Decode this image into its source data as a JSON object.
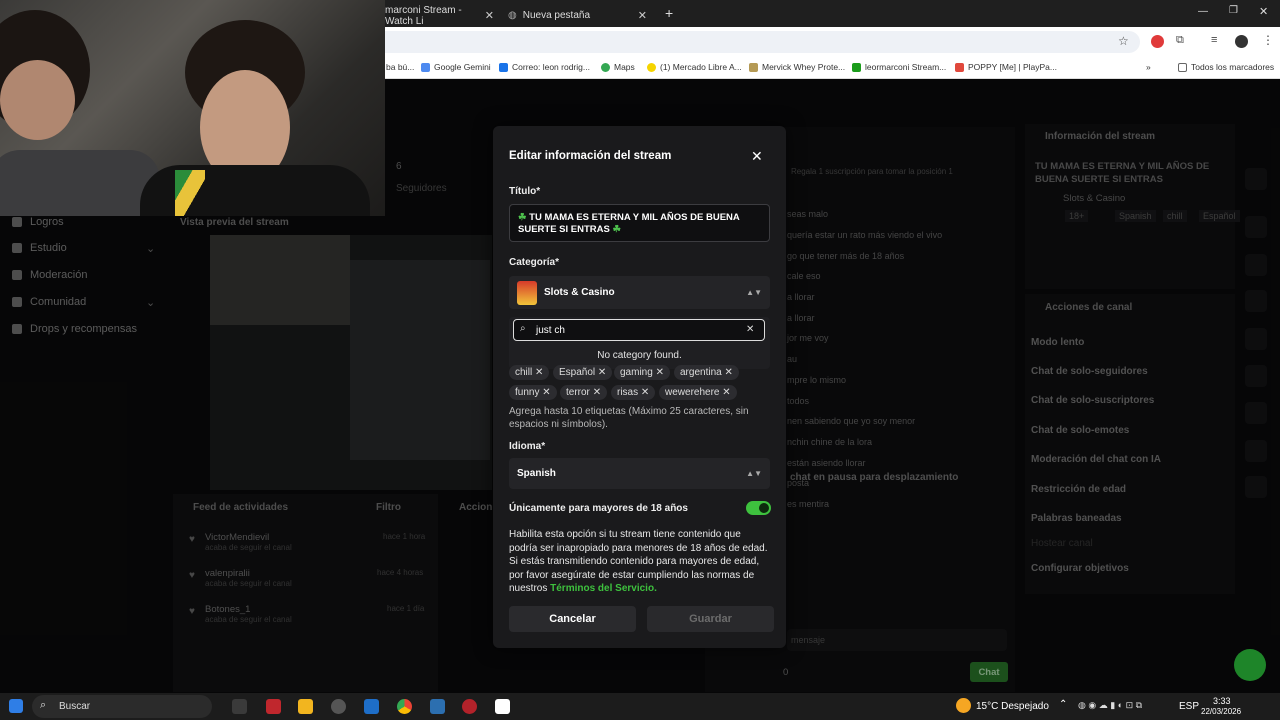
{
  "browser": {
    "tabs": [
      {
        "title": "marconi Stream - Watch Li"
      },
      {
        "title": "Nueva pestaña"
      }
    ],
    "bookmarks": [
      {
        "label": "ba bú..."
      },
      {
        "label": "Google Gemini"
      },
      {
        "label": "Correo: leon rodrig..."
      },
      {
        "label": "Maps"
      },
      {
        "label": "(1) Mercado Libre A..."
      },
      {
        "label": "Mervick Whey Prote..."
      },
      {
        "label": "leormarconi Stream..."
      },
      {
        "label": "POPPY [Me] | PlayPa..."
      },
      {
        "label": "Todos los marcadores"
      }
    ]
  },
  "sidebar": {
    "items": [
      {
        "label": "Logros"
      },
      {
        "label": "Estudio"
      },
      {
        "label": "Moderación"
      },
      {
        "label": "Comunidad"
      },
      {
        "label": "Drops y recompensas"
      }
    ]
  },
  "dashboard": {
    "followers_count": "6",
    "followers_label": "Seguidores",
    "preview_title": "Vista previa del stream",
    "activity": {
      "title": "Feed de actividades",
      "filter": "Filtro",
      "items": [
        {
          "name": "VictorMendievil",
          "time": "hace 1 hora",
          "desc": "acaba de seguir el canal"
        },
        {
          "name": "valenpiralii",
          "time": "hace 4 horas",
          "desc": "acaba de seguir el canal"
        },
        {
          "name": "Botones_1",
          "time": "hace 1 día",
          "desc": "acaba de seguir el canal"
        }
      ]
    },
    "actions_title": "Accion",
    "chat": {
      "banner": "Regala 1 suscripción para tomar la posición 1",
      "lines": [
        "seas malo",
        "quería estar un rato más viendo el vivo",
        "go que tener más de 18 años",
        "cale eso",
        "a llorar",
        "a llorar",
        "jor me voy",
        "au",
        "mpre lo mismo",
        "todos",
        "nen sabiendo que yo soy menor",
        "nchin chine de la lora",
        "están asiendo llorar",
        "posta",
        "es mentira"
      ],
      "paused": "chat en pausa para desplazamiento",
      "input_placeholder": "mensaje",
      "chat_button": "Chat",
      "points": "0"
    },
    "stream_info": {
      "title": "Información del stream",
      "stream_title": "TU MAMA ES ETERNA Y MIL AÑOS DE BUENA SUERTE SI ENTRAS",
      "category": "Slots & Casino",
      "tags": [
        "18+",
        "Spanish",
        "chill",
        "Español"
      ]
    },
    "channel_actions": {
      "title": "Acciones de canal",
      "items": [
        "Modo lento",
        "Chat de solo-seguidores",
        "Chat de solo-suscriptores",
        "Chat de solo-emotes",
        "Moderación del chat con IA",
        "Restricción de edad",
        "Palabras baneadas",
        "Hostear canal",
        "Configurar objetivos"
      ]
    }
  },
  "modal": {
    "title": "Editar información del stream",
    "title_label": "Título*",
    "title_value": "TU MAMA ES ETERNA Y MIL AÑOS DE BUENA SUERTE SI ENTRAS",
    "category_label": "Categoría*",
    "category_value": "Slots & Casino",
    "search_value": "just ch",
    "no_results": "No category found.",
    "tags": [
      "chill",
      "Español",
      "gaming",
      "argentina",
      "funny",
      "terror",
      "risas",
      "wewerehere"
    ],
    "tags_help": "Agrega hasta 10 etiquetas (Máximo 25 caracteres, sin espacios ni símbolos).",
    "language_label": "Idioma*",
    "language_value": "Spanish",
    "adult_label": "Únicamente para mayores de 18 años",
    "adult_help": "Habilita esta opción si tu stream tiene contenido que podría ser inapropiado para menores de 18 años de edad. Si estás transmitiendo contenido para mayores de edad, por favor asegúrate de estar cumpliendo las normas de nuestros",
    "terms_link": "Términos del Servicio.",
    "cancel": "Cancelar",
    "save": "Guardar",
    "accent": "#3ec13e"
  },
  "taskbar": {
    "search": "Buscar",
    "weather": "15°C  Despejado",
    "lang": "ESP",
    "time": "3:33",
    "date": "22/03/2026"
  }
}
